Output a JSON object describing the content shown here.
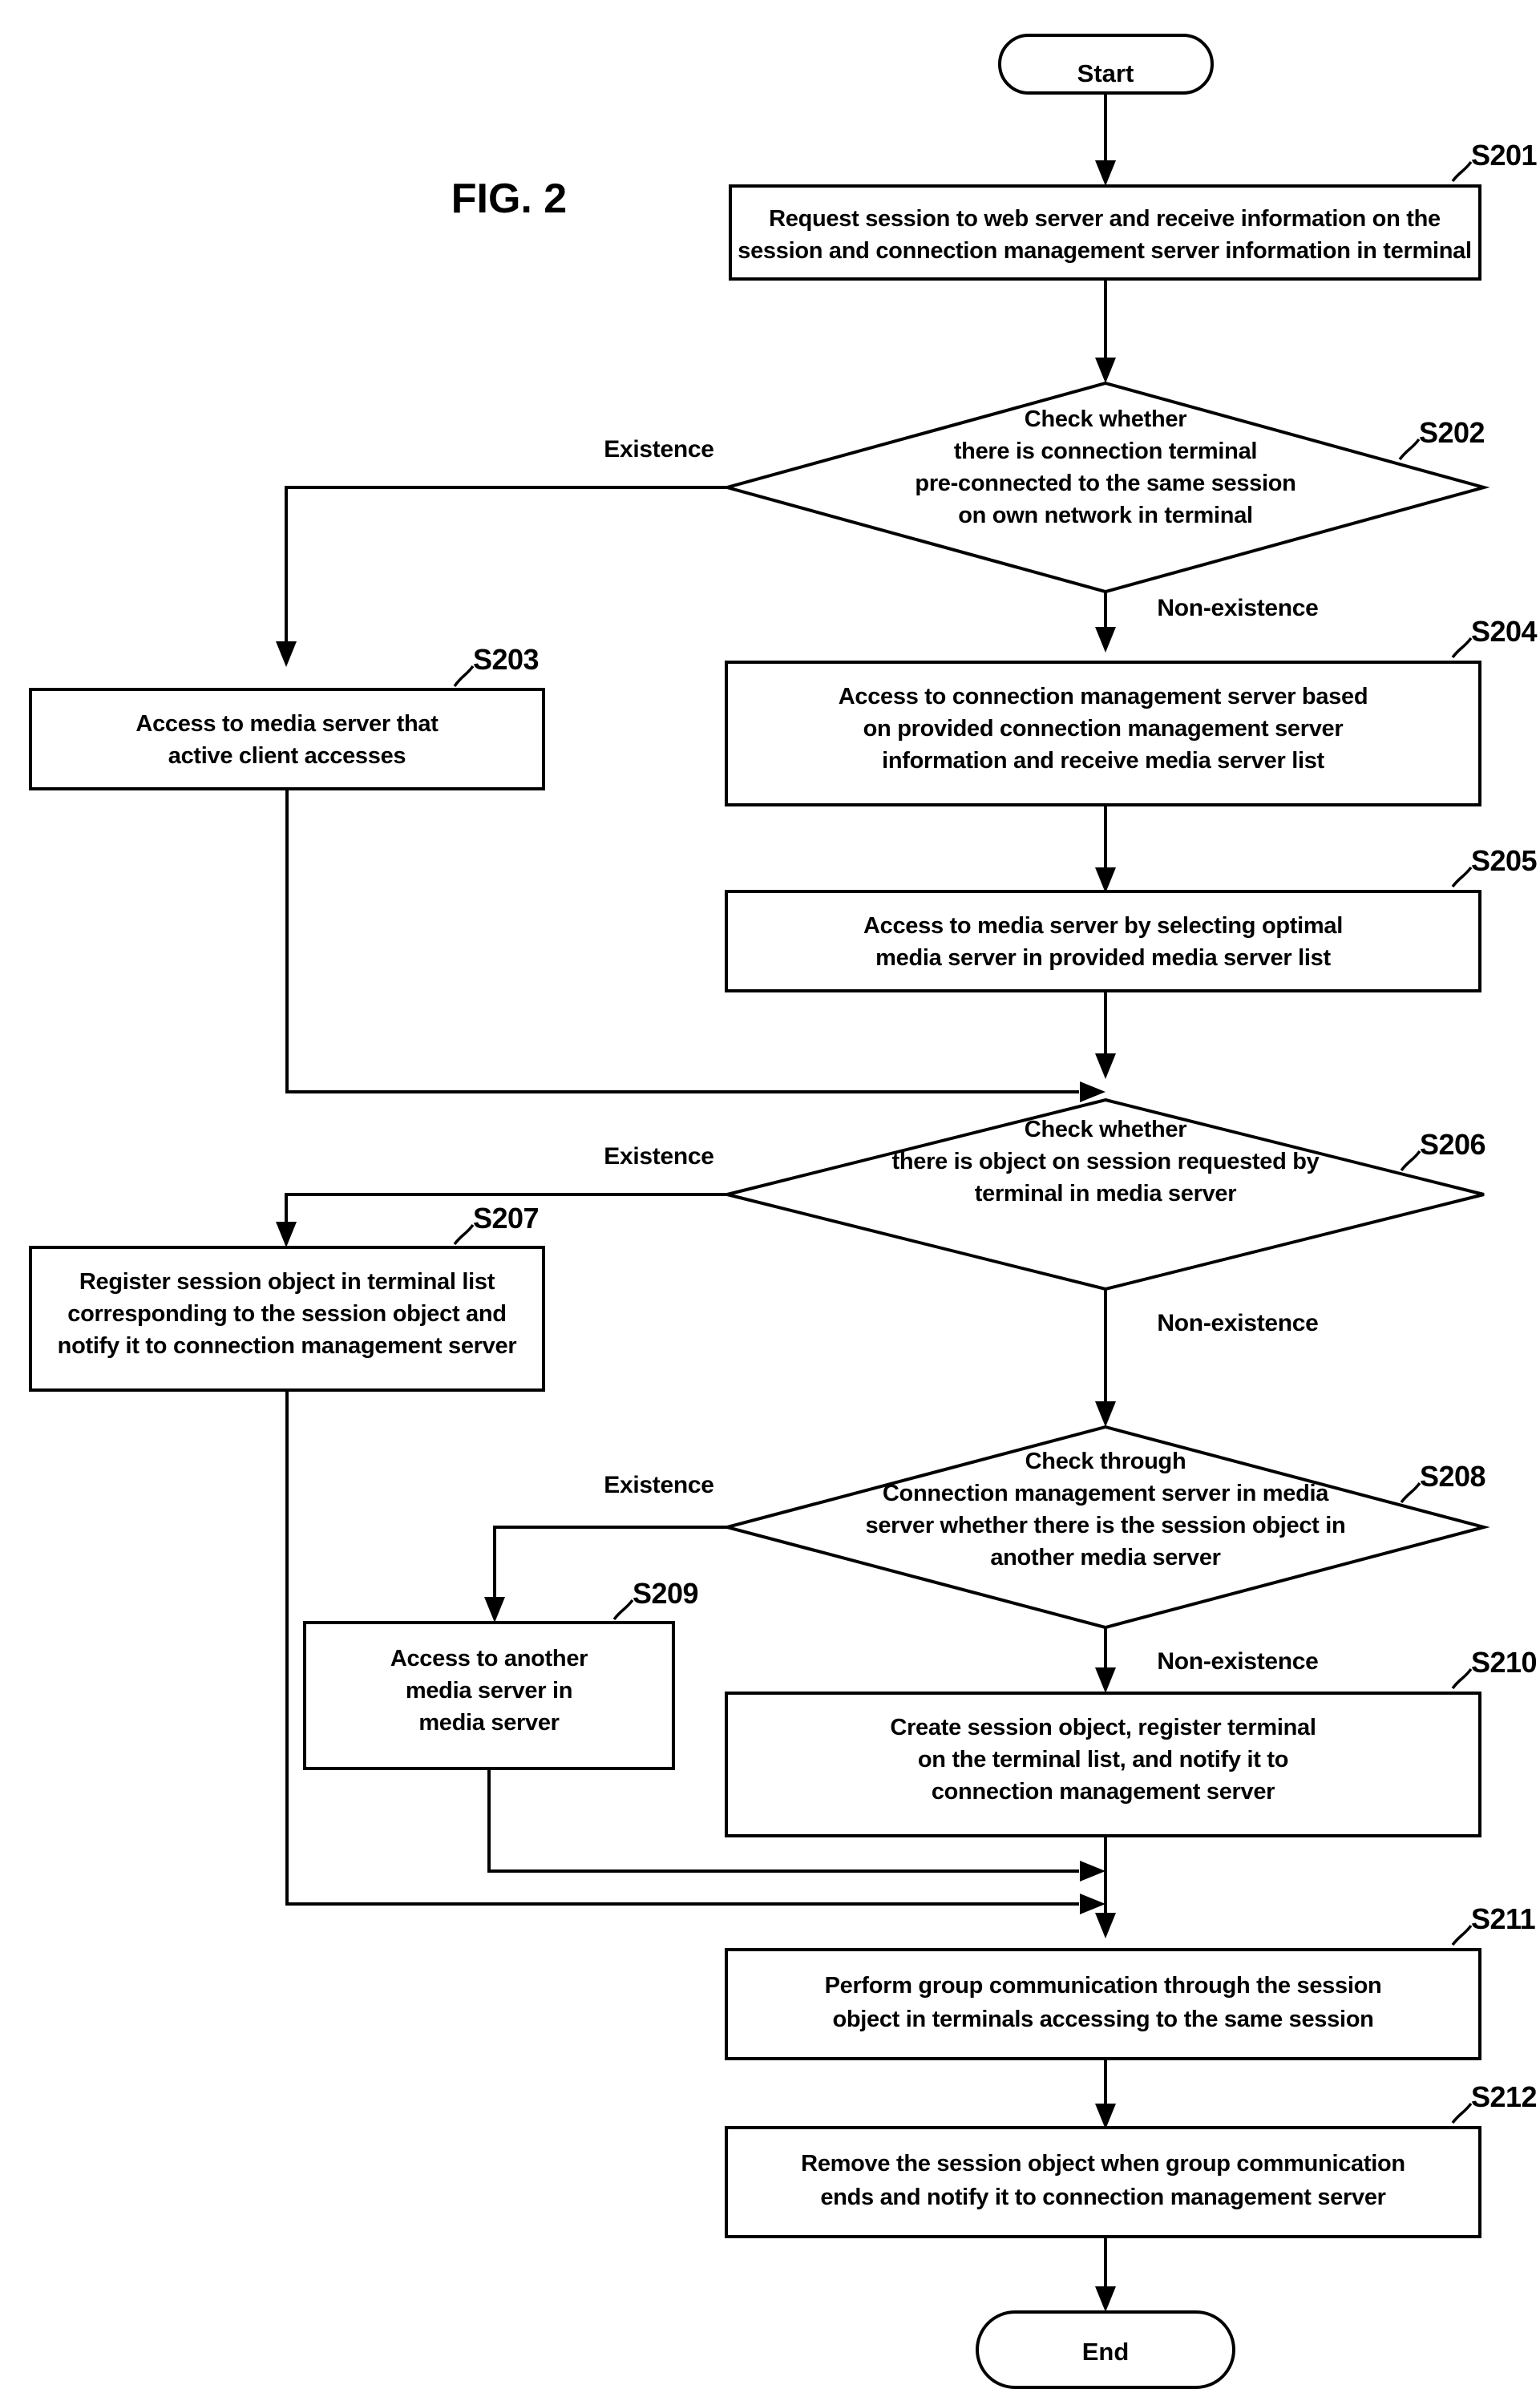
{
  "figure": {
    "label": "FIG. 2"
  },
  "terminators": {
    "start": "Start",
    "end": "End"
  },
  "branch_labels": {
    "existence": "Existence",
    "non_existence": "Non-existence"
  },
  "steps": [
    {
      "id": "S201",
      "type": "process",
      "lines": [
        "Request session to web server and receive information on the",
        "session and connection management server information in terminal"
      ]
    },
    {
      "id": "S202",
      "type": "decision",
      "lines": [
        "Check whether",
        "there is connection terminal",
        "pre-connected to the same session",
        "on own network in terminal"
      ],
      "yes_label": "Existence",
      "no_label": "Non-existence"
    },
    {
      "id": "S203",
      "type": "process",
      "lines": [
        "Access to media server that",
        "active client accesses"
      ]
    },
    {
      "id": "S204",
      "type": "process",
      "lines": [
        "Access to connection management server based",
        "on provided connection management server",
        "information and receive media server list"
      ]
    },
    {
      "id": "S205",
      "type": "process",
      "lines": [
        "Access to media server by selecting optimal",
        "media server in provided media server list"
      ]
    },
    {
      "id": "S206",
      "type": "decision",
      "lines": [
        "Check whether",
        "there is object on session requested by",
        "terminal in media server"
      ],
      "yes_label": "Existence",
      "no_label": "Non-existence"
    },
    {
      "id": "S207",
      "type": "process",
      "lines": [
        "Register session object in terminal list",
        "corresponding to the session object and",
        "notify it to connection management server"
      ]
    },
    {
      "id": "S208",
      "type": "decision",
      "lines": [
        "Check through",
        "Connection management server in media",
        "server whether there is the session object in",
        "another media server"
      ],
      "yes_label": "Existence",
      "no_label": "Non-existence"
    },
    {
      "id": "S209",
      "type": "process",
      "lines": [
        "Access to another",
        "media server in",
        "media server"
      ]
    },
    {
      "id": "S210",
      "type": "process",
      "lines": [
        "Create session object, register terminal",
        "on the terminal list, and notify it to",
        "connection management server"
      ]
    },
    {
      "id": "S211",
      "type": "process",
      "lines": [
        "Perform group communication through the session",
        "object in terminals accessing to the same session"
      ]
    },
    {
      "id": "S212",
      "type": "process",
      "lines": [
        "Remove the session object when group communication",
        "ends and notify it to connection management server"
      ]
    }
  ],
  "colors": {
    "ink": "#000000",
    "paper": "#ffffff"
  }
}
